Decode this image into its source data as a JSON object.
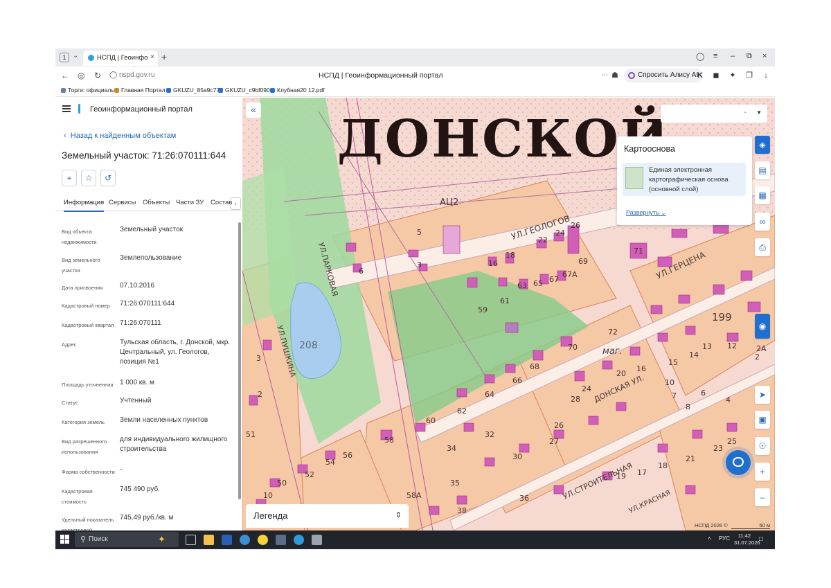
{
  "browser": {
    "tab_count": "1",
    "tab_title": "НСПД | Геоинформацио",
    "url": "nspd.gov.ru",
    "page_title": "НСПД | Геоинформационный портал",
    "alisa_label": "Спросить Алису AI",
    "bookmarks": [
      "Торги: официаль",
      "Главная Портал З",
      "GKUZU_85a9c777",
      "GKUZU_c9bf0901",
      "Клубная20 12.pdf"
    ]
  },
  "panel": {
    "brand": "Геоинформационный портал",
    "back_link": "Назад к найденным объектам",
    "title": "Земельный участок: 71:26:070111:644",
    "tabs": [
      "Информация",
      "Сервисы",
      "Объекты",
      "Части ЗУ",
      "Состав"
    ],
    "rows": [
      {
        "k": "Вид объекта недвижимости",
        "v": "Земельный участок"
      },
      {
        "k": "Вид земельного участка",
        "v": "Землепользование"
      },
      {
        "k": "Дата присвоения",
        "v": "07.10.2016"
      },
      {
        "k": "Кадастровый номер",
        "v": "71:26:070111:644"
      },
      {
        "k": "Кадастровый квартал",
        "v": "71:26:070111"
      },
      {
        "k": "Адрес",
        "v": "Тульская область, г. Донской, мкр. Центральный, ул. Геологов, позиция №1"
      },
      {
        "k": "Площадь уточненная",
        "v": "1 000 кв. м"
      },
      {
        "k": "Статус",
        "v": "Учтенный"
      },
      {
        "k": "Категория земель",
        "v": "Земли населенных пунктов"
      },
      {
        "k": "Вид разрешенного использования",
        "v": "для индивидуального жилищного строительства"
      },
      {
        "k": "Форма собственности",
        "v": "-"
      },
      {
        "k": "Кадастровая стоимость",
        "v": "745 490 руб."
      },
      {
        "k": "Удельный показатель кадастровой",
        "v": "745,49 руб./кв. м"
      }
    ]
  },
  "map": {
    "overlay_title": "ДОНСКОЙ",
    "select_value": "-",
    "basemap": {
      "header": "Картооснова",
      "layer": "Единая электронная картографическая основа (основной слой)",
      "expand": "Развернуть"
    },
    "legend": "Легенда",
    "copyright": "НСПД 2026 ©",
    "scale": "50 м",
    "labels": {
      "acq": "АЦ2",
      "geologov": "УЛ.ГЕОЛОГОВ",
      "gercena": "УЛ.ГЕРЦЕНА",
      "parkovaya": "УЛ.ПАРКОВАЯ",
      "pushkina": "УЛ.ПУШКИНА",
      "donskaya": "ДОНСКАЯ УЛ.",
      "stroitelnaya": "УЛ.СТРОИТЕЛЬНАЯ",
      "krasnaya": "УЛ.КРАСНАЯ",
      "mag": "маг.",
      "lake_num": "208",
      "n199": "199"
    },
    "house_numbers": [
      "5",
      "3",
      "6",
      "16",
      "18",
      "22",
      "24",
      "26",
      "59",
      "61",
      "63",
      "65",
      "67",
      "67А",
      "69",
      "71",
      "72",
      "70",
      "68",
      "66",
      "64",
      "62",
      "60",
      "58",
      "34",
      "32",
      "30",
      "27",
      "26",
      "28",
      "24",
      "20",
      "16",
      "15",
      "14",
      "13",
      "12",
      "10",
      "8",
      "7",
      "6",
      "4",
      "2",
      "2А",
      "36",
      "35",
      "38",
      "58А",
      "50",
      "52",
      "54",
      "56",
      "10",
      "3",
      "2",
      "51",
      "19",
      "17",
      "18",
      "21",
      "23",
      "25"
    ]
  },
  "taskbar": {
    "search_placeholder": "Поиск",
    "lang": "РУС",
    "time": "11:42",
    "date": "31.07.2026"
  }
}
